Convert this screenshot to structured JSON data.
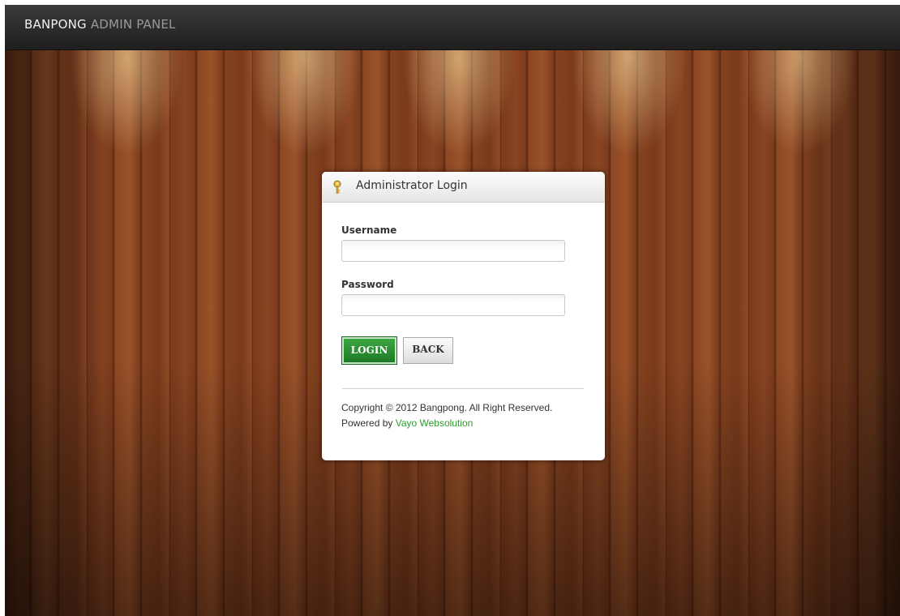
{
  "header": {
    "brand_strong": "BANPONG",
    "brand_light": "ADMIN PANEL"
  },
  "login_panel": {
    "title": "Administrator Login",
    "username_label": "Username",
    "username_value": "",
    "password_label": "Password",
    "password_value": "",
    "login_button": "LOGIN",
    "back_button": "BACK",
    "copyright": "Copyright © 2012 Bangpong. All Right Reserved.",
    "powered_by_prefix": "Powered by ",
    "powered_by_link": "Vayo Websolution"
  },
  "icons": {
    "panel_icon": "key-icon"
  },
  "colors": {
    "login_button": "#2a8f31",
    "link": "#2e9a2e",
    "topbar": "#262626"
  }
}
